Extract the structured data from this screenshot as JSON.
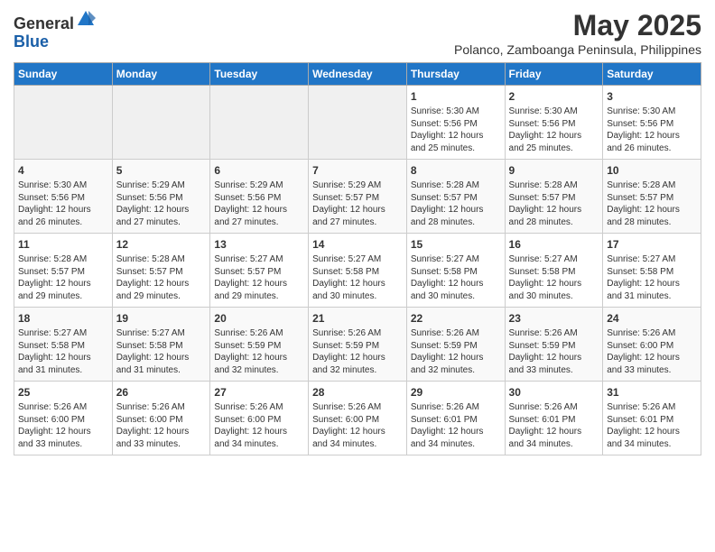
{
  "header": {
    "logo_line1": "General",
    "logo_line2": "Blue",
    "title": "May 2025",
    "subtitle": "Polanco, Zamboanga Peninsula, Philippines"
  },
  "calendar": {
    "days_of_week": [
      "Sunday",
      "Monday",
      "Tuesday",
      "Wednesday",
      "Thursday",
      "Friday",
      "Saturday"
    ],
    "weeks": [
      [
        {
          "day": "",
          "content": ""
        },
        {
          "day": "",
          "content": ""
        },
        {
          "day": "",
          "content": ""
        },
        {
          "day": "",
          "content": ""
        },
        {
          "day": "1",
          "content": "Sunrise: 5:30 AM\nSunset: 5:56 PM\nDaylight: 12 hours\nand 25 minutes."
        },
        {
          "day": "2",
          "content": "Sunrise: 5:30 AM\nSunset: 5:56 PM\nDaylight: 12 hours\nand 25 minutes."
        },
        {
          "day": "3",
          "content": "Sunrise: 5:30 AM\nSunset: 5:56 PM\nDaylight: 12 hours\nand 26 minutes."
        }
      ],
      [
        {
          "day": "4",
          "content": "Sunrise: 5:30 AM\nSunset: 5:56 PM\nDaylight: 12 hours\nand 26 minutes."
        },
        {
          "day": "5",
          "content": "Sunrise: 5:29 AM\nSunset: 5:56 PM\nDaylight: 12 hours\nand 27 minutes."
        },
        {
          "day": "6",
          "content": "Sunrise: 5:29 AM\nSunset: 5:56 PM\nDaylight: 12 hours\nand 27 minutes."
        },
        {
          "day": "7",
          "content": "Sunrise: 5:29 AM\nSunset: 5:57 PM\nDaylight: 12 hours\nand 27 minutes."
        },
        {
          "day": "8",
          "content": "Sunrise: 5:28 AM\nSunset: 5:57 PM\nDaylight: 12 hours\nand 28 minutes."
        },
        {
          "day": "9",
          "content": "Sunrise: 5:28 AM\nSunset: 5:57 PM\nDaylight: 12 hours\nand 28 minutes."
        },
        {
          "day": "10",
          "content": "Sunrise: 5:28 AM\nSunset: 5:57 PM\nDaylight: 12 hours\nand 28 minutes."
        }
      ],
      [
        {
          "day": "11",
          "content": "Sunrise: 5:28 AM\nSunset: 5:57 PM\nDaylight: 12 hours\nand 29 minutes."
        },
        {
          "day": "12",
          "content": "Sunrise: 5:28 AM\nSunset: 5:57 PM\nDaylight: 12 hours\nand 29 minutes."
        },
        {
          "day": "13",
          "content": "Sunrise: 5:27 AM\nSunset: 5:57 PM\nDaylight: 12 hours\nand 29 minutes."
        },
        {
          "day": "14",
          "content": "Sunrise: 5:27 AM\nSunset: 5:58 PM\nDaylight: 12 hours\nand 30 minutes."
        },
        {
          "day": "15",
          "content": "Sunrise: 5:27 AM\nSunset: 5:58 PM\nDaylight: 12 hours\nand 30 minutes."
        },
        {
          "day": "16",
          "content": "Sunrise: 5:27 AM\nSunset: 5:58 PM\nDaylight: 12 hours\nand 30 minutes."
        },
        {
          "day": "17",
          "content": "Sunrise: 5:27 AM\nSunset: 5:58 PM\nDaylight: 12 hours\nand 31 minutes."
        }
      ],
      [
        {
          "day": "18",
          "content": "Sunrise: 5:27 AM\nSunset: 5:58 PM\nDaylight: 12 hours\nand 31 minutes."
        },
        {
          "day": "19",
          "content": "Sunrise: 5:27 AM\nSunset: 5:58 PM\nDaylight: 12 hours\nand 31 minutes."
        },
        {
          "day": "20",
          "content": "Sunrise: 5:26 AM\nSunset: 5:59 PM\nDaylight: 12 hours\nand 32 minutes."
        },
        {
          "day": "21",
          "content": "Sunrise: 5:26 AM\nSunset: 5:59 PM\nDaylight: 12 hours\nand 32 minutes."
        },
        {
          "day": "22",
          "content": "Sunrise: 5:26 AM\nSunset: 5:59 PM\nDaylight: 12 hours\nand 32 minutes."
        },
        {
          "day": "23",
          "content": "Sunrise: 5:26 AM\nSunset: 5:59 PM\nDaylight: 12 hours\nand 33 minutes."
        },
        {
          "day": "24",
          "content": "Sunrise: 5:26 AM\nSunset: 6:00 PM\nDaylight: 12 hours\nand 33 minutes."
        }
      ],
      [
        {
          "day": "25",
          "content": "Sunrise: 5:26 AM\nSunset: 6:00 PM\nDaylight: 12 hours\nand 33 minutes."
        },
        {
          "day": "26",
          "content": "Sunrise: 5:26 AM\nSunset: 6:00 PM\nDaylight: 12 hours\nand 33 minutes."
        },
        {
          "day": "27",
          "content": "Sunrise: 5:26 AM\nSunset: 6:00 PM\nDaylight: 12 hours\nand 34 minutes."
        },
        {
          "day": "28",
          "content": "Sunrise: 5:26 AM\nSunset: 6:00 PM\nDaylight: 12 hours\nand 34 minutes."
        },
        {
          "day": "29",
          "content": "Sunrise: 5:26 AM\nSunset: 6:01 PM\nDaylight: 12 hours\nand 34 minutes."
        },
        {
          "day": "30",
          "content": "Sunrise: 5:26 AM\nSunset: 6:01 PM\nDaylight: 12 hours\nand 34 minutes."
        },
        {
          "day": "31",
          "content": "Sunrise: 5:26 AM\nSunset: 6:01 PM\nDaylight: 12 hours\nand 34 minutes."
        }
      ]
    ]
  }
}
